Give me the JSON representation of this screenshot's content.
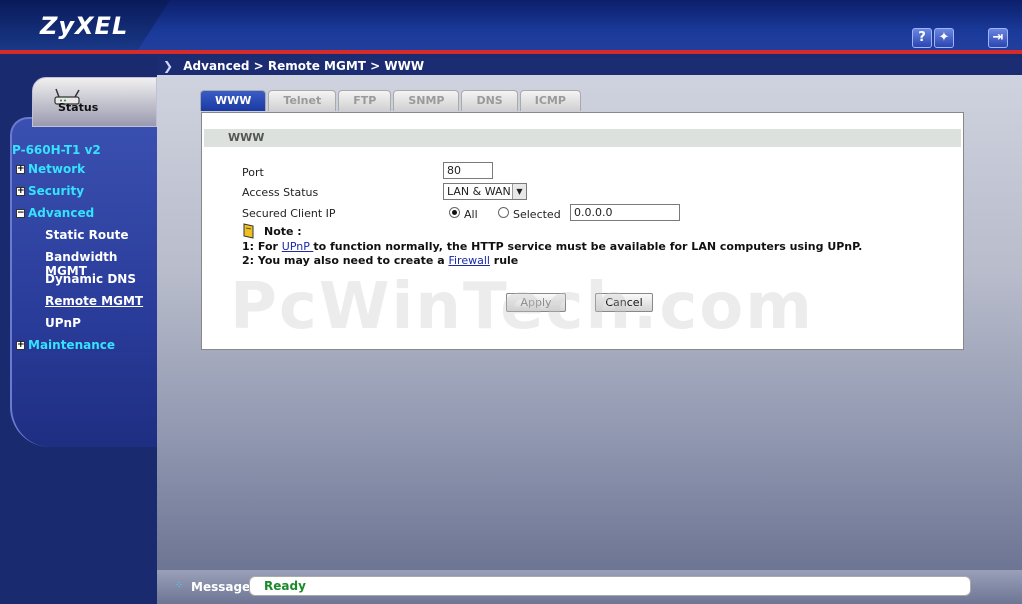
{
  "brand": {
    "logo": "ZyXEL"
  },
  "header": {
    "help_icon": "question-icon",
    "wizard_icon": "wand-icon",
    "logout_icon": "logout-icon"
  },
  "breadcrumb": "Advanced > Remote MGMT > WWW",
  "sidebar": {
    "status_label": "Status",
    "device_name": "P-660H-T1 v2",
    "groups": [
      {
        "label": "Network",
        "expanded": false
      },
      {
        "label": "Security",
        "expanded": false
      },
      {
        "label": "Advanced",
        "expanded": true
      },
      {
        "label": "Maintenance",
        "expanded": false
      }
    ],
    "advanced_items": [
      "Static Route",
      "Bandwidth MGMT",
      "Dynamic DNS",
      "Remote MGMT",
      "UPnP"
    ],
    "active_item": "Remote MGMT"
  },
  "tabs": [
    "WWW",
    "Telnet",
    "FTP",
    "SNMP",
    "DNS",
    "ICMP"
  ],
  "active_tab": "WWW",
  "panel": {
    "title": "WWW",
    "port_label": "Port",
    "port_value": "80",
    "access_label": "Access Status",
    "access_value": "LAN & WAN",
    "secured_label": "Secured Client IP",
    "radio_all": "All",
    "radio_selected": "Selected",
    "selected_ip": "0.0.0.0",
    "note_title": "Note :",
    "note1_prefix": "1: For ",
    "note1_link": "UPnP ",
    "note1_suffix": " to function normally, the HTTP service must be available for LAN computers using UPnP.",
    "note2_prefix": "2: You may also need to create a ",
    "note2_link": "Firewall",
    "note2_suffix": " rule",
    "apply_label": "Apply",
    "cancel_label": "Cancel",
    "watermark": "PcWinTech.com"
  },
  "message": {
    "label": "Message",
    "value": "Ready"
  },
  "colors": {
    "nav_text": "#35e2ff",
    "header_red": "#d62b2b",
    "message_green": "#1a8a2a"
  }
}
